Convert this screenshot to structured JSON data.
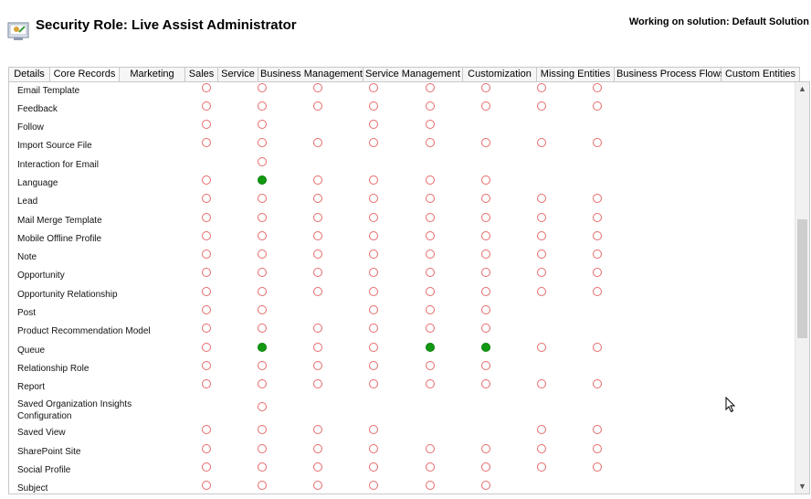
{
  "header": {
    "title": "Security Role: Live Assist Administrator",
    "solution_text": "Working on solution: Default Solution"
  },
  "tabs": [
    {
      "label": "Details",
      "active": false
    },
    {
      "label": "Core Records",
      "active": true
    },
    {
      "label": "Marketing",
      "active": false
    },
    {
      "label": "Sales",
      "active": false
    },
    {
      "label": "Service",
      "active": false
    },
    {
      "label": "Business Management",
      "active": false
    },
    {
      "label": "Service Management",
      "active": false
    },
    {
      "label": "Customization",
      "active": false
    },
    {
      "label": "Missing Entities",
      "active": false
    },
    {
      "label": "Business Process Flows",
      "active": false
    },
    {
      "label": "Custom Entities",
      "active": false
    }
  ],
  "colors": {
    "none_circle": "#e86a6a",
    "full_circle": "#119a11"
  },
  "privilege_columns": 8,
  "rows": [
    {
      "label": "Email Template",
      "privileges": [
        "none",
        "none",
        "none",
        "none",
        "none",
        "none",
        "none",
        "none"
      ]
    },
    {
      "label": "Feedback",
      "privileges": [
        "none",
        "none",
        "none",
        "none",
        "none",
        "none",
        "none",
        "none"
      ]
    },
    {
      "label": "Follow",
      "privileges": [
        "none",
        "none",
        "",
        "none",
        "none",
        "",
        "",
        ""
      ]
    },
    {
      "label": "Import Source File",
      "privileges": [
        "none",
        "none",
        "none",
        "none",
        "none",
        "none",
        "none",
        "none"
      ]
    },
    {
      "label": "Interaction for Email",
      "privileges": [
        "",
        "none",
        "",
        "",
        "",
        "",
        "",
        ""
      ]
    },
    {
      "label": "Language",
      "privileges": [
        "none",
        "full",
        "none",
        "none",
        "none",
        "none",
        "",
        ""
      ]
    },
    {
      "label": "Lead",
      "privileges": [
        "none",
        "none",
        "none",
        "none",
        "none",
        "none",
        "none",
        "none"
      ]
    },
    {
      "label": "Mail Merge Template",
      "privileges": [
        "none",
        "none",
        "none",
        "none",
        "none",
        "none",
        "none",
        "none"
      ]
    },
    {
      "label": "Mobile Offline Profile",
      "privileges": [
        "none",
        "none",
        "none",
        "none",
        "none",
        "none",
        "none",
        "none"
      ]
    },
    {
      "label": "Note",
      "privileges": [
        "none",
        "none",
        "none",
        "none",
        "none",
        "none",
        "none",
        "none"
      ]
    },
    {
      "label": "Opportunity",
      "privileges": [
        "none",
        "none",
        "none",
        "none",
        "none",
        "none",
        "none",
        "none"
      ]
    },
    {
      "label": "Opportunity Relationship",
      "privileges": [
        "none",
        "none",
        "none",
        "none",
        "none",
        "none",
        "none",
        "none"
      ]
    },
    {
      "label": "Post",
      "privileges": [
        "none",
        "none",
        "",
        "none",
        "none",
        "none",
        "",
        ""
      ]
    },
    {
      "label": "Product Recommendation Model",
      "privileges": [
        "none",
        "none",
        "none",
        "none",
        "none",
        "none",
        "",
        ""
      ]
    },
    {
      "label": "Queue",
      "privileges": [
        "none",
        "full",
        "none",
        "none",
        "full",
        "full",
        "none",
        "none"
      ]
    },
    {
      "label": "Relationship Role",
      "privileges": [
        "none",
        "none",
        "none",
        "none",
        "none",
        "none",
        "",
        ""
      ]
    },
    {
      "label": "Report",
      "privileges": [
        "none",
        "none",
        "none",
        "none",
        "none",
        "none",
        "none",
        "none"
      ]
    },
    {
      "label": "Saved Organization Insights Configuration",
      "privileges": [
        "",
        "none",
        "",
        "",
        "",
        "",
        "",
        ""
      ]
    },
    {
      "label": "Saved View",
      "privileges": [
        "none",
        "none",
        "none",
        "none",
        "",
        "",
        "none",
        "none"
      ]
    },
    {
      "label": "SharePoint Site",
      "privileges": [
        "none",
        "none",
        "none",
        "none",
        "none",
        "none",
        "none",
        "none"
      ]
    },
    {
      "label": "Social Profile",
      "privileges": [
        "none",
        "none",
        "none",
        "none",
        "none",
        "none",
        "none",
        "none"
      ]
    },
    {
      "label": "Subject",
      "privileges": [
        "none",
        "none",
        "none",
        "none",
        "none",
        "none",
        "",
        ""
      ]
    }
  ]
}
